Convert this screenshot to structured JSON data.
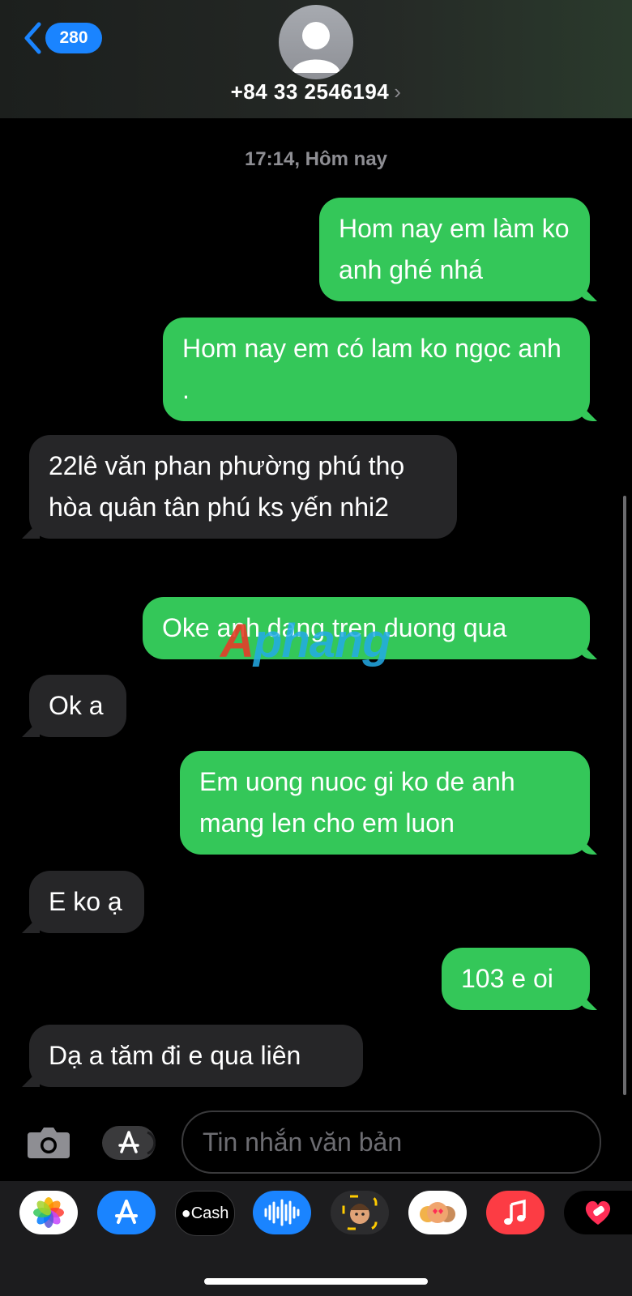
{
  "header": {
    "back_count": "280",
    "contact": "+84 33 2546194",
    "chevron": "›"
  },
  "timestamp": "17:14, Hôm nay",
  "messages": [
    {
      "dir": "out",
      "text": "Hom nay em làm ko anh ghé nhá"
    },
    {
      "dir": "out",
      "text": "Hom nay em có lam ko ngọc anh ."
    },
    {
      "dir": "in",
      "text": "22lê văn phan phường phú thọ hòa quân tân phú ks yến nhi2"
    },
    {
      "dir": "out",
      "text": "Oke anh dang tren duong qua"
    },
    {
      "dir": "in",
      "text": "Ok a"
    },
    {
      "dir": "out",
      "text": "Em uong nuoc gi ko de anh mang len cho em luon"
    },
    {
      "dir": "in",
      "text": "E ko ạ"
    },
    {
      "dir": "out",
      "text": "103 e oi"
    },
    {
      "dir": "in",
      "text": "Dạ a tăm đi e qua liên"
    }
  ],
  "watermark": {
    "first": "A",
    "rest": "phang"
  },
  "composer": {
    "placeholder": "Tin nhắn văn bản"
  },
  "drawer": {
    "apps": [
      {
        "icon": "photos-icon"
      },
      {
        "icon": "app-store-icon"
      },
      {
        "icon": "apple-cash-icon",
        "label": "Cash"
      },
      {
        "icon": "audio-message-icon"
      },
      {
        "icon": "memoji-icon"
      },
      {
        "icon": "memoji-stickers-icon"
      },
      {
        "icon": "music-icon"
      },
      {
        "icon": "digital-touch-icon"
      }
    ]
  },
  "colors": {
    "outgoing": "#34c759",
    "incoming": "#262628",
    "accent": "#1a84ff"
  }
}
